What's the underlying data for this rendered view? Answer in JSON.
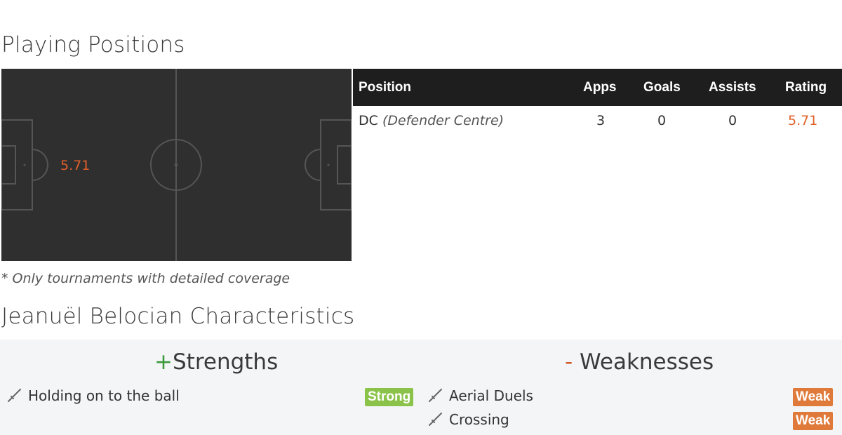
{
  "sections": {
    "playing_positions_title": "Playing Positions",
    "characteristics_title": "Jeanuël Belocian Characteristics"
  },
  "pitch": {
    "rating": "5.71"
  },
  "footnote": "* Only tournaments with detailed coverage",
  "positions_table": {
    "headers": {
      "position": "Position",
      "apps": "Apps",
      "goals": "Goals",
      "assists": "Assists",
      "rating": "Rating"
    },
    "rows": [
      {
        "position_code": "DC",
        "position_full": "(Defender Centre)",
        "apps": "3",
        "goals": "0",
        "assists": "0",
        "rating": "5.71"
      }
    ]
  },
  "characteristics": {
    "strengths_sign": "+",
    "strengths_label": "Strengths",
    "weaknesses_sign": "-",
    "weaknesses_label": "Weaknesses",
    "strengths": [
      {
        "label": "Holding on to the ball",
        "level": "Strong"
      }
    ],
    "weaknesses": [
      {
        "label": "Aerial Duels",
        "level": "Weak"
      },
      {
        "label": "Crossing",
        "level": "Weak"
      }
    ]
  },
  "colors": {
    "rating": "#e0602a",
    "strong": "#8bc34a",
    "weak": "#e07a3a",
    "pitch": "#2f2f2f"
  },
  "icons": {
    "characteristic": "sword-icon"
  }
}
